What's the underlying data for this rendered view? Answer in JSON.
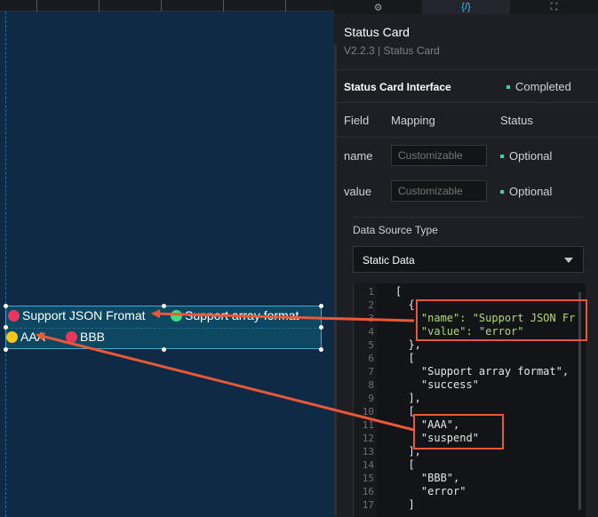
{
  "panel": {
    "tabs": [
      {
        "icon": "sliders-icon",
        "glyph": "⚙"
      },
      {
        "icon": "code-braces-icon",
        "glyph": "{/}"
      },
      {
        "icon": "interaction-icon",
        "glyph": "⛶"
      }
    ],
    "title": "Status Card",
    "version": "V2.2.3 | Status Card",
    "interface_label": "Status Card Interface",
    "interface_status": "Completed",
    "columns": {
      "field": "Field",
      "mapping": "Mapping",
      "status": "Status"
    },
    "fields": [
      {
        "name": "name",
        "placeholder": "Customizable",
        "status": "Optional"
      },
      {
        "name": "value",
        "placeholder": "Customizable",
        "status": "Optional"
      }
    ],
    "data_source_label": "Data Source Type",
    "data_source_value": "Static Data"
  },
  "code": {
    "line_numbers": [
      "1",
      "2",
      "3",
      "4",
      "5",
      "6",
      "7",
      "8",
      "9",
      "10",
      "11",
      "12",
      "13",
      "14",
      "15",
      "16",
      "17"
    ],
    "lines": [
      "[",
      "  {",
      "    \"name\": \"Support JSON Fr",
      "    \"value\": \"error\"",
      "  },",
      "  [",
      "    \"Support array format\",",
      "    \"success\"",
      "  ],",
      "  [",
      "    \"AAA\",",
      "    \"suspend\"",
      "  ],",
      "  [",
      "    \"BBB\",",
      "    \"error\"",
      "  ]"
    ]
  },
  "canvas": {
    "items": [
      {
        "label": "Support JSON Fromat",
        "color": "#e8365d"
      },
      {
        "label": "Support array format",
        "color": "#3ddc84"
      },
      {
        "label": "AAA",
        "color": "#f5c518"
      },
      {
        "label": "BBB",
        "color": "#e8365d"
      }
    ]
  },
  "colors": {
    "accent": "#2fc6ff",
    "annotation": "#e85a37",
    "ok": "#2ed6b6"
  }
}
